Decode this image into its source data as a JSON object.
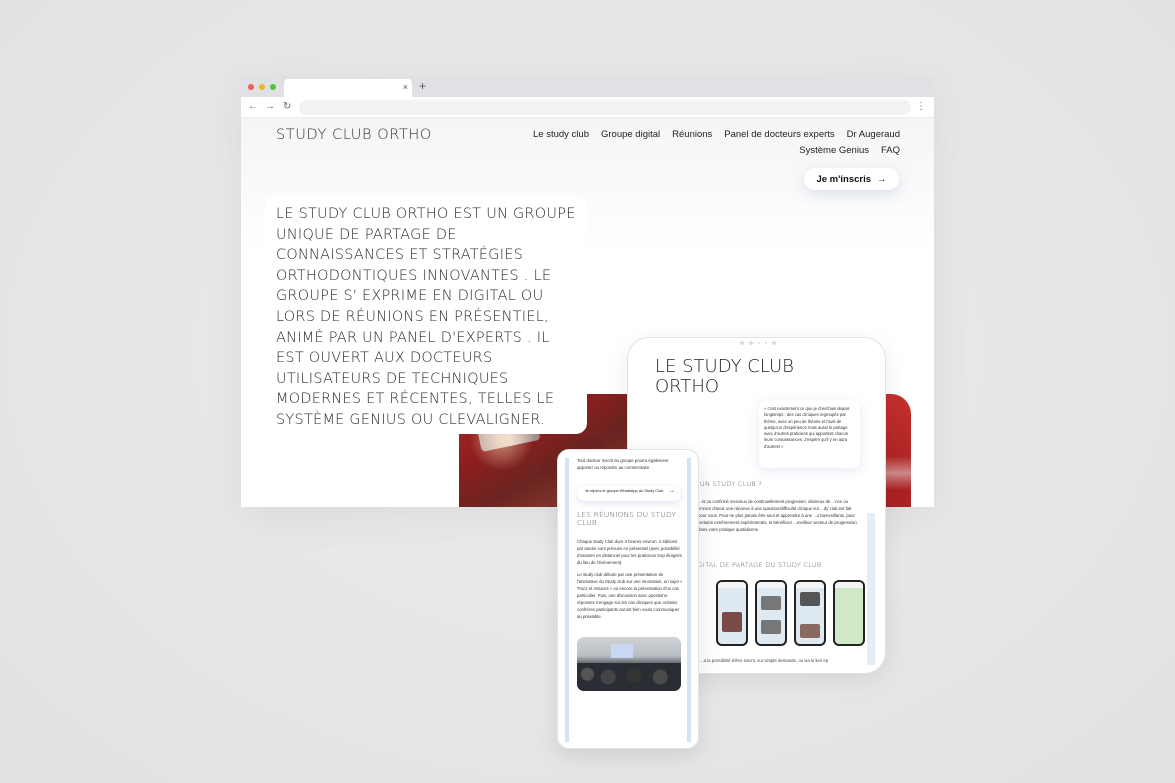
{
  "browser": {
    "tab_close": "×",
    "new_tab": "+",
    "nav_back": "←",
    "nav_forward": "→",
    "reload": "↻",
    "menu": "⋮",
    "url": ""
  },
  "site": {
    "logo": "STUDY CLUB ORTHO",
    "nav": [
      {
        "label": "Le study club"
      },
      {
        "label": "Groupe digital"
      },
      {
        "label": "Réunions"
      },
      {
        "label": "Panel de docteurs experts"
      },
      {
        "label": "Dr Augeraud"
      },
      {
        "label": "Système Genius"
      },
      {
        "label": "FAQ"
      }
    ],
    "cta_label": "Je m'inscris",
    "cta_icon": "→",
    "hero_text": "LE STUDY CLUB ORTHO EST UN GROUPE UNIQUE DE PARTAGE DE CONNAISSANCES ET STRATÉGIES ORTHODONTIQUES INNOVANTES . LE GROUPE S' EXPRIME EN DIGITAL OU LORS DE RÉUNIONS EN PRÉSENTIEL, ANIMÉ PAR UN PANEL D'EXPERTS . IL EST OUVERT AUX DOCTEURS UTILISATEURS DE TECHNIQUES MODERNES ET RÉCENTES, TELLES LE SYSTÈME GENIUS OU CLEVALIGNER."
  },
  "tablet": {
    "title_line1": "LE STUDY CLUB",
    "title_line2": "ORTHO",
    "quote": "« c'est exactement ce que je cherchais depuis longtemps : des cas cliniques regroupés par thème, avec un peu de théorie et l'avis de quelqu'un d'expérience mais aussi le partage avec d'autres praticiens qui apportent chacun leurs connaissances. J'espère qu'il y en aura d'autres! »",
    "heading1": "UN STUDY CLUB ?",
    "body": "...nt ou confirmé soucieux de continuellement progresser, désireux de ...nce ou encore d'avoir une réponse à une question/difficulté clinique sur ...dy club est fait pour vous. Pour ne plus jamais être seul et apprendre à une ...s bienveillants, pour certains extrêmement expérimentés, et bénéficier ...meilleur vecteur de progression dans votre pratique quotidienne.",
    "heading2": "DIGITAL DE PARTAGE DU STUDY CLUB",
    "footer": "...a la possibilité d'être inscrit, sur simple demande, ou via le lien ep"
  },
  "phone": {
    "intro": "Tout docteur inscrit au groupe pourra également apporter ou répondre au commentaire",
    "button_label": "Je rejoins le groupe WhatsApp du Study Club",
    "button_icon": "→",
    "heading": "LES RÉUNIONS DU STUDY CLUB",
    "para1": "Chaque study Club dure 3 heures environ. 2 éditions par année sont prévues en présentiel (avec possibilité d'assister en distanciel pour les praticiens trop éloignés du lieu de l'événement).",
    "para2": "Le study club débute par une présentation de l'animateur du Study club sur une innovation, un sujet « Trucs et Astuces » ou encore la présentation d'un cas particulier. Puis, une discussion avec questions-réponses s'engage sur les cas cliniques que certains confrères participants auront bien voulu communiquer au préalable."
  }
}
